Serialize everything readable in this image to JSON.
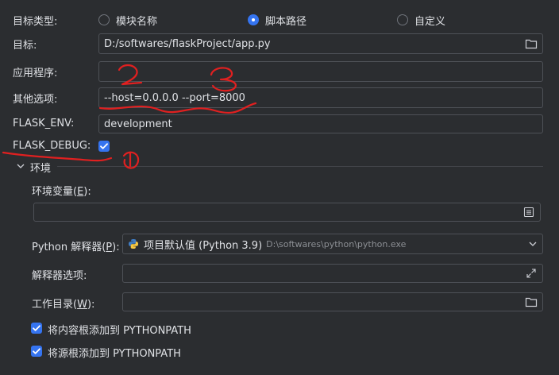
{
  "target_type": {
    "label": "目标类型:",
    "options": [
      {
        "label": "模块名称",
        "selected": false
      },
      {
        "label": "脚本路径",
        "selected": true
      },
      {
        "label": "自定义",
        "selected": false
      }
    ]
  },
  "target": {
    "label": "目标:",
    "value": "D:/softwares/flaskProject/app.py",
    "icon": "folder-icon"
  },
  "app": {
    "label": "应用程序:",
    "value": ""
  },
  "other_options": {
    "label": "其他选项:",
    "value": "--host=0.0.0.0 --port=8000"
  },
  "flask_env": {
    "label": "FLASK_ENV:",
    "value": "development"
  },
  "flask_debug": {
    "label": "FLASK_DEBUG:",
    "checked": true
  },
  "environment": {
    "section_label": "环境",
    "env_vars": {
      "label_pre": "环境变量(",
      "mnemonic": "E",
      "label_post": "):",
      "value": ""
    },
    "interpreter": {
      "label_pre": "Python 解释器(",
      "mnemonic": "P",
      "label_post": "):",
      "name": "项目默认值 (Python 3.9)",
      "path": "D:\\softwares\\python\\python.exe"
    },
    "interpreter_options": {
      "label": "解释器选项:",
      "value": ""
    },
    "working_dir": {
      "label_pre": "工作目录(",
      "mnemonic": "W",
      "label_post": "):",
      "value": ""
    },
    "add_content_roots": {
      "label": "将内容根添加到 PYTHONPATH",
      "checked": true
    },
    "add_source_roots": {
      "label": "将源根添加到 PYTHONPATH",
      "checked": true
    }
  },
  "annotations": {
    "mark1": "1",
    "mark2": "2",
    "mark3": "3"
  },
  "colors": {
    "accent": "#3574f0",
    "background": "#2b2d30",
    "annotation": "#e02020"
  }
}
